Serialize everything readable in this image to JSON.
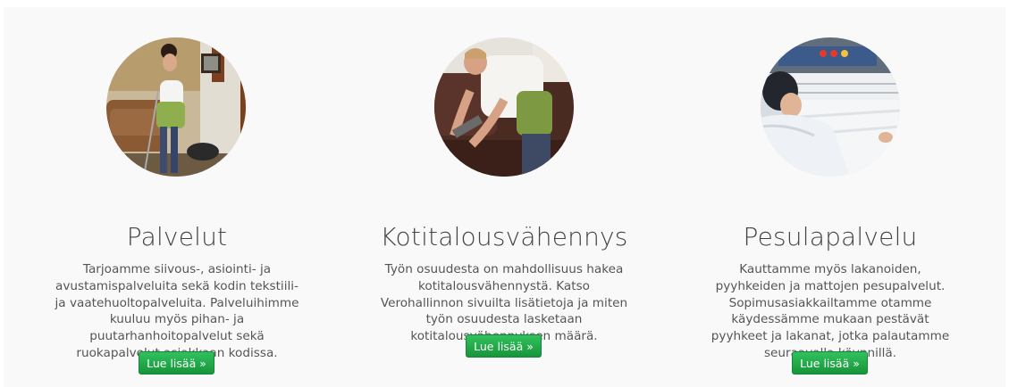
{
  "services": [
    {
      "title": "Palvelut",
      "text": "Tarjoamme siivous-, asiointi- ja avustamispalveluita sekä kodin tekstiili- ja vaatehuoltopalveluita. Palveluihimme kuuluu myös pihan- ja puutarhanhoitopalvelut sekä ruokapalvelut asiakkaan kodissa.",
      "button_label": "Lue lisää »",
      "image": "cleaner-vacuuming-photo"
    },
    {
      "title": "Kotitalousvähennys",
      "text": "Työn osuudesta on mahdollisuus hakea kotitalousvähennystä. Katso Verohallinnon sivuilta lisätietoja ja miten työn osuudesta lasketaan kotitalousvähennyksen määrä.",
      "button_label": "Lue lisää »",
      "image": "sofa-cleaning-photo"
    },
    {
      "title": "Pesulapalvelu",
      "text": "Kauttamme myös lakanoiden, pyyhkeiden ja mattojen pesupalvelut. Sopimusasiakkailtamme otamme käydessämme mukaan pestävät pyyhkeet ja lakanat, jotka palautamme seuraavalla käynnillä.",
      "button_label": "Lue lisää »",
      "image": "laundry-ironing-photo"
    }
  ],
  "colors": {
    "button": "#1fa646",
    "background": "#f9f9f9",
    "heading": "#444444",
    "text": "#555555"
  }
}
